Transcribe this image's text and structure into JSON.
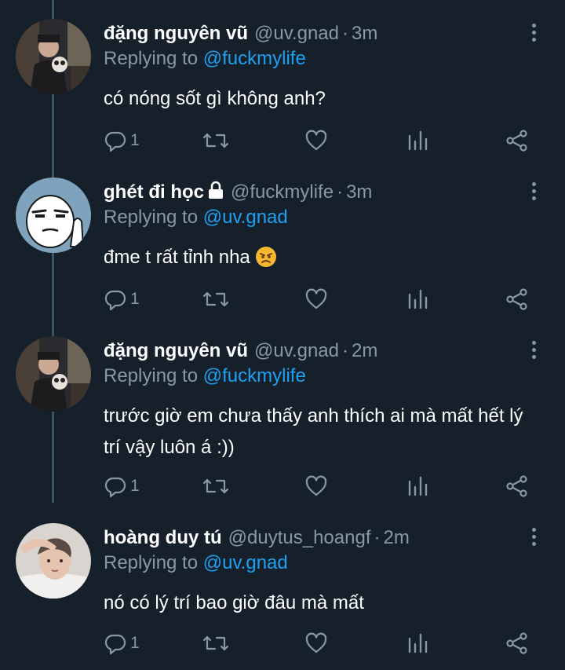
{
  "tweets": [
    {
      "name": "đặng nguyên vũ",
      "handle": "@uv.gnad",
      "sep": "·",
      "time": "3m",
      "reply_prefix": "Replying to",
      "reply_to": "@fuckmylife",
      "text": "có nóng sốt gì không anh?",
      "reply_count": "1",
      "avatar": "photo-avatar"
    },
    {
      "name": "ghét đi học",
      "handle": "@fuckmylife",
      "sep": "·",
      "time": "3m",
      "reply_prefix": "Replying to",
      "reply_to": "@uv.gnad",
      "text": "đme t rất tỉnh nha",
      "emoji": "angry-face",
      "reply_count": "1",
      "protected": true,
      "avatar": "meme-face-avatar"
    },
    {
      "name": "đặng nguyên vũ",
      "handle": "@uv.gnad",
      "sep": "·",
      "time": "2m",
      "reply_prefix": "Replying to",
      "reply_to": "@fuckmylife",
      "text": "trước giờ em chưa thấy anh thích ai mà mất hết lý trí vậy luôn á :))",
      "reply_count": "1",
      "avatar": "photo-avatar"
    },
    {
      "name": "hoàng duy tú",
      "handle": "@duytus_hoangf",
      "sep": "·",
      "time": "2m",
      "reply_prefix": "Replying to",
      "reply_to": "@uv.gnad",
      "text": "nó có lý trí bao giờ đâu mà mất",
      "reply_count": "1",
      "avatar": "selfie-avatar"
    }
  ],
  "icons": {
    "reply": "reply-icon",
    "retweet": "retweet-icon",
    "like": "heart-icon",
    "stats": "stats-icon",
    "share": "share-icon",
    "more": "more-icon"
  },
  "colors": {
    "background": "#15202b",
    "text": "#ffffff",
    "secondary": "#8899a6",
    "accent": "#1da1f2",
    "thread_line": "#3d5466"
  }
}
